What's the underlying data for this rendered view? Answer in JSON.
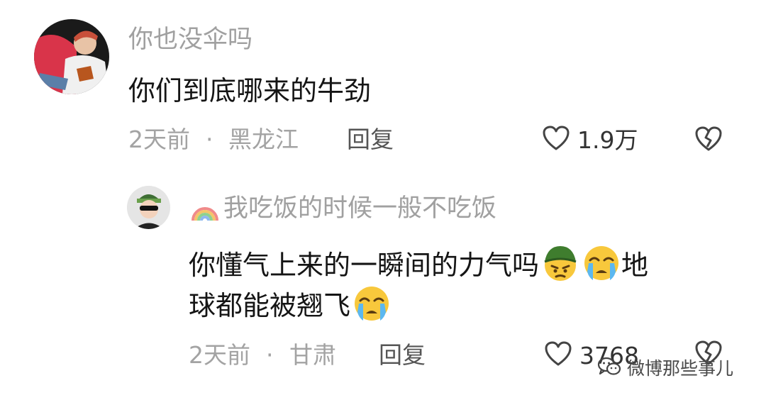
{
  "comments": [
    {
      "username": "你也没伞吗",
      "text": "你们到底哪来的牛劲",
      "time": "2天前",
      "separator": "·",
      "location": "黑龙江",
      "reply_label": "回复",
      "likes": "1.9万"
    },
    {
      "username": "我吃饭的时候一般不吃饭",
      "text_line1_a": "你懂气上来的一瞬间的力气吗",
      "text_line1_b": "地",
      "text_line2": "球都能被翘飞",
      "time": "2天前",
      "separator": "·",
      "location": "甘肃",
      "reply_label": "回复",
      "likes": "3768"
    }
  ],
  "watermark": {
    "text": "微博那些事儿",
    "icon": "wechat-icon"
  },
  "icons": [
    "heart-icon",
    "broken-heart-icon",
    "rainbow-icon",
    "angry-emoji-icon",
    "crying-emoji-icon"
  ]
}
